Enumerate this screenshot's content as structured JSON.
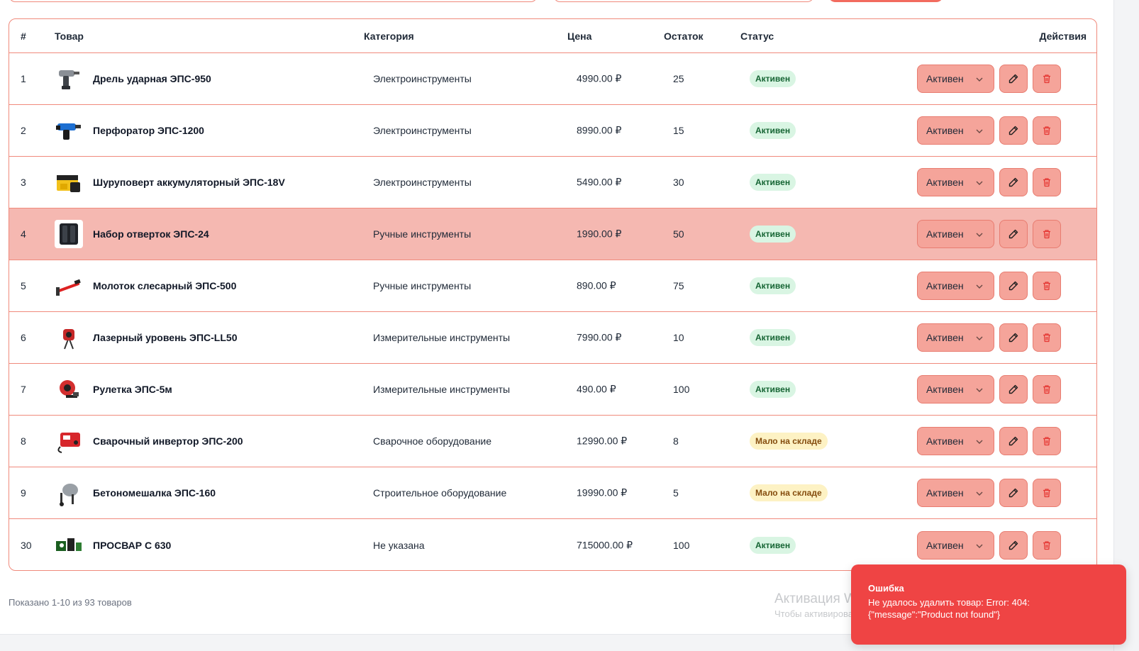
{
  "table": {
    "headers": {
      "num": "#",
      "product": "Товар",
      "category": "Категория",
      "price": "Цена",
      "stock": "Остаток",
      "status": "Статус",
      "actions": "Действия"
    },
    "rows": [
      {
        "num": "1",
        "name": "Дрель ударная ЭПС-950",
        "category": "Электроинструменты",
        "price": "4990.00 ₽",
        "stock": "25",
        "status": "Активен",
        "status_type": "active",
        "select": "Активен",
        "thumb": "drill"
      },
      {
        "num": "2",
        "name": "Перфоратор ЭПС-1200",
        "category": "Электроинструменты",
        "price": "8990.00 ₽",
        "stock": "15",
        "status": "Активен",
        "status_type": "active",
        "select": "Активен",
        "thumb": "hammer-drill"
      },
      {
        "num": "3",
        "name": "Шуруповерт аккумуляторный ЭПС-18V",
        "category": "Электроинструменты",
        "price": "5490.00 ₽",
        "stock": "30",
        "status": "Активен",
        "status_type": "active",
        "select": "Активен",
        "thumb": "screwdriver-kit"
      },
      {
        "num": "4",
        "name": "Набор отверток ЭПС-24",
        "category": "Ручные инструменты",
        "price": "1990.00 ₽",
        "stock": "50",
        "status": "Активен",
        "status_type": "active",
        "select": "Активен",
        "thumb": "bit-set"
      },
      {
        "num": "5",
        "name": "Молоток слесарный ЭПС-500",
        "category": "Ручные инструменты",
        "price": "890.00 ₽",
        "stock": "75",
        "status": "Активен",
        "status_type": "active",
        "select": "Активен",
        "thumb": "hammer"
      },
      {
        "num": "6",
        "name": "Лазерный уровень ЭПС-LL50",
        "category": "Измерительные инструменты",
        "price": "7990.00 ₽",
        "stock": "10",
        "status": "Активен",
        "status_type": "active",
        "select": "Активен",
        "thumb": "laser-level"
      },
      {
        "num": "7",
        "name": "Рулетка ЭПС-5м",
        "category": "Измерительные инструменты",
        "price": "490.00 ₽",
        "stock": "100",
        "status": "Активен",
        "status_type": "active",
        "select": "Активен",
        "thumb": "tape-measure"
      },
      {
        "num": "8",
        "name": "Сварочный инвертор ЭПС-200",
        "category": "Сварочное оборудование",
        "price": "12990.00 ₽",
        "stock": "8",
        "status": "Мало на складе",
        "status_type": "low",
        "select": "Активен",
        "thumb": "welder"
      },
      {
        "num": "9",
        "name": "Бетономешалка ЭПС-160",
        "category": "Строительное оборудование",
        "price": "19990.00 ₽",
        "stock": "5",
        "status": "Мало на складе",
        "status_type": "low",
        "select": "Активен",
        "thumb": "mixer"
      },
      {
        "num": "30",
        "name": "ПРОСВАР С 630",
        "category": "Не указана",
        "price": "715000.00 ₽",
        "stock": "100",
        "status": "Активен",
        "status_type": "active",
        "select": "Активен",
        "thumb": "welder-set"
      }
    ],
    "highlighted_row": 3
  },
  "pager": {
    "summary": "Показано 1-10 из 93 товаров"
  },
  "toast": {
    "title": "Ошибка",
    "message": "Не удалось удалить товар: Error: 404: {\"message\":\"Product not found\"}"
  },
  "watermark": {
    "line1": "Активация Windows",
    "line2": "Чтобы активировать Windows, перейдите в раздел \"Параметры\"."
  },
  "colors": {
    "accent": "#f26b5f",
    "border": "#f08a7c",
    "button_bg": "#f5a49a",
    "highlight_row": "#f5b8b1",
    "toast": "#ef4444"
  }
}
